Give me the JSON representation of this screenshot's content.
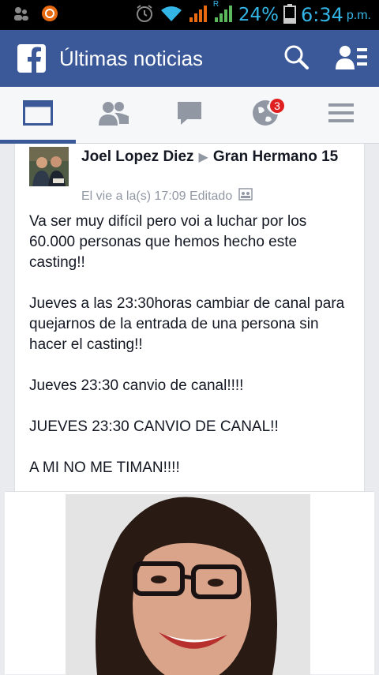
{
  "status_bar": {
    "battery_percent": "24%",
    "time": "6:34",
    "ampm": "p.m.",
    "roaming_label": "R"
  },
  "header": {
    "title": "Últimas noticias"
  },
  "tabs": {
    "notifications_count": "3"
  },
  "post": {
    "author": "Joel Lopez Diez",
    "group": "Gran Hermano 15",
    "meta": "El vie a la(s) 17:09 Editado",
    "paragraphs": [
      "Va ser muy difícil pero voi a luchar por los 60.000 personas que hemos hecho este casting!!",
      "Jueves a las 23:30horas cambiar de canal para quejarnos de la entrada de una persona sin hacer el casting!!",
      "Jueves 23:30 canvio de canal!!!!",
      "JUEVES 23:30 CANVIO DE CANAL!!",
      "A MI NO ME TIMAN!!!!"
    ]
  },
  "colors": {
    "brand": "#3b5998",
    "status_accent": "#33b5e5",
    "badge": "#e02020"
  }
}
